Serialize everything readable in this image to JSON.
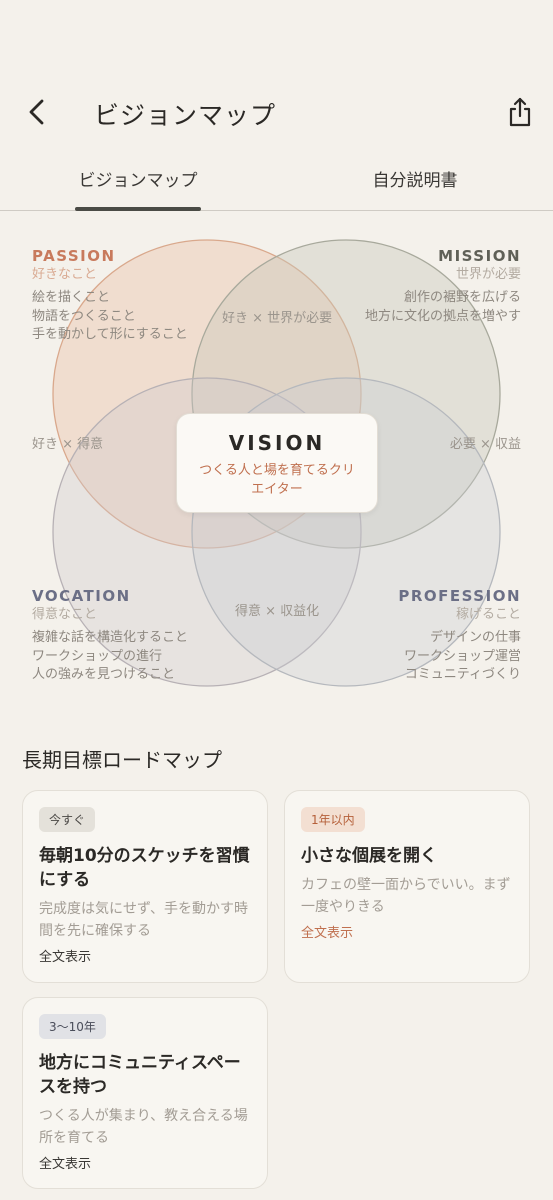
{
  "header": {
    "title": "ビジョンマップ"
  },
  "tabs": [
    {
      "label": "ビジョンマップ"
    },
    {
      "label": "自分説明書"
    }
  ],
  "venn": {
    "passion": {
      "title": "PASSION",
      "subtitle": "好きなこと",
      "items": [
        "絵を描くこと",
        "物語をつくること",
        "手を動かして形にすること"
      ]
    },
    "mission": {
      "title": "MISSION",
      "subtitle": "世界が必要",
      "items": [
        "創作の裾野を広げる",
        "地方に文化の拠点を増やす"
      ]
    },
    "vocation": {
      "title": "VOCATION",
      "subtitle": "得意なこと",
      "items": [
        "複雑な話を構造化すること",
        "ワークショップの進行",
        "人の強みを見つけること"
      ]
    },
    "profession": {
      "title": "PROFESSION",
      "subtitle": "稼げること",
      "items": [
        "デザインの仕事",
        "ワークショップ運営",
        "コミュニティづくり"
      ]
    },
    "intersections": {
      "top": "好き × 世界が必要",
      "left": "好き × 得意",
      "right": "必要 × 収益",
      "bottom": "得意 × 収益化"
    },
    "colors": {
      "passion": "#e9b89b",
      "mission": "#c7c9ba",
      "vocation": "#cfc8cc",
      "profession": "#c8ccd1"
    }
  },
  "vision": {
    "title": "VISION",
    "text": "つくる人と場を育てるクリエイター"
  },
  "roadmap": {
    "title": "長期目標ロードマップ",
    "cards": [
      {
        "badge": "今すぐ",
        "title": "毎朝10分のスケッチを習慣にする",
        "desc": "完成度は気にせず、手を動かす時間を先に確保する",
        "link": "全文表示"
      },
      {
        "badge": "1年以内",
        "title": "小さな個展を開く",
        "desc": "カフェの壁一面からでいい。まず一度やりきる",
        "link": "全文表示"
      },
      {
        "badge": "3〜10年",
        "title": "地方にコミュニティスペースを持つ",
        "desc": "つくる人が集まり、教え合える場所を育てる",
        "link": "全文表示"
      }
    ]
  }
}
